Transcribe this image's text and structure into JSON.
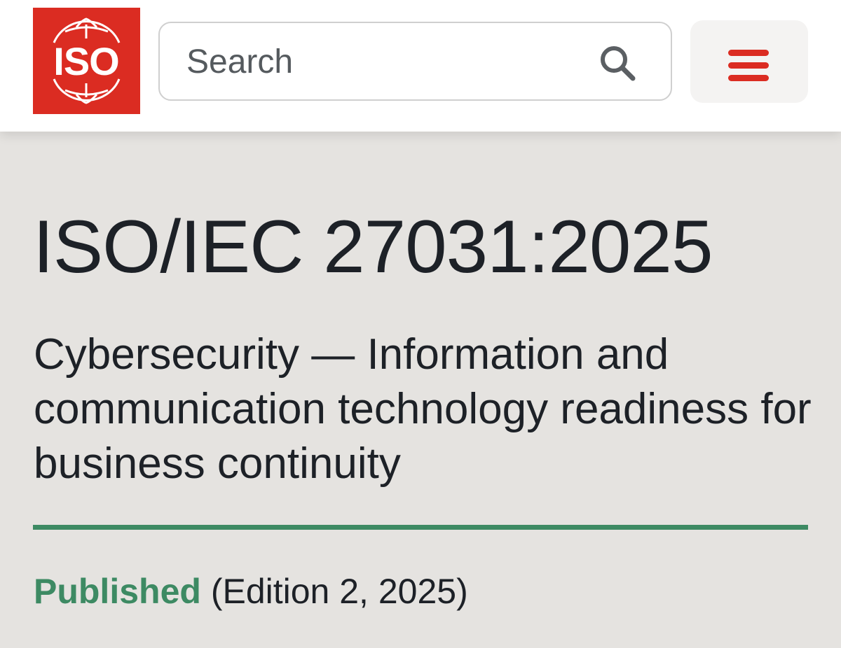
{
  "header": {
    "logo_text": "ISO",
    "search": {
      "placeholder": "Search",
      "value": ""
    },
    "icons": {
      "search": "search-icon",
      "menu": "hamburger-menu-icon"
    },
    "colors": {
      "brand": "#db2c22"
    }
  },
  "standard": {
    "code": "ISO/IEC 27031:2025",
    "title": "Cybersecurity — Information and communication technology readiness for business continuity",
    "status": "Published",
    "edition": "(Edition 2, 2025)",
    "colors": {
      "status": "#3d8a63"
    }
  }
}
